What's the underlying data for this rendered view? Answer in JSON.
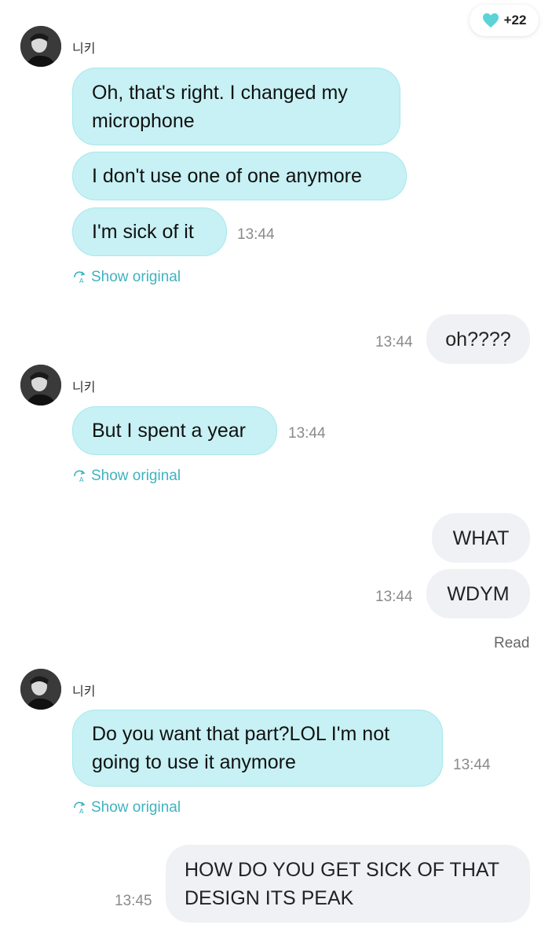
{
  "reactions": {
    "icon": "heart-icon",
    "count": "+22",
    "color": "#5bd3d8"
  },
  "sender_name": "니키",
  "colors": {
    "incoming_bubble": "#c7f1f4",
    "outgoing_bubble": "#f0f1f5",
    "accent": "#3fb3bf"
  },
  "show_original_label": "Show original",
  "read_label": "Read",
  "messages": [
    {
      "text": "Oh, that's right. I changed my microphone"
    },
    {
      "text": "I don't use one of one anymore"
    },
    {
      "text": "I'm sick of it",
      "time": "13:44"
    },
    {
      "text": "oh????",
      "time": "13:44"
    },
    {
      "text": "But I spent a year",
      "time": "13:44"
    },
    {
      "text": "WHAT"
    },
    {
      "text": "WDYM",
      "time": "13:44"
    },
    {
      "text": "Do you want that part?LOL I'm not going to use it anymore",
      "time": "13:44"
    },
    {
      "text": "HOW DO YOU GET SICK OF THAT DESIGN ITS PEAK",
      "time": "13:45"
    }
  ]
}
